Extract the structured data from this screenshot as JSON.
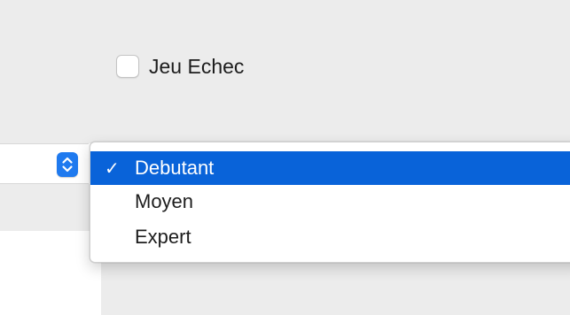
{
  "checkbox": {
    "label": "Jeu Echec",
    "checked": false
  },
  "popup": {
    "selected_value": "Debutant",
    "icon": "up-down-chevron-icon",
    "accent_color": "#1f7aef"
  },
  "menu": {
    "check_mark": "✓",
    "selection_color": "#0963d9",
    "items": [
      {
        "label": "Debutant",
        "selected": true
      },
      {
        "label": "Moyen",
        "selected": false
      },
      {
        "label": "Expert",
        "selected": false
      }
    ]
  }
}
